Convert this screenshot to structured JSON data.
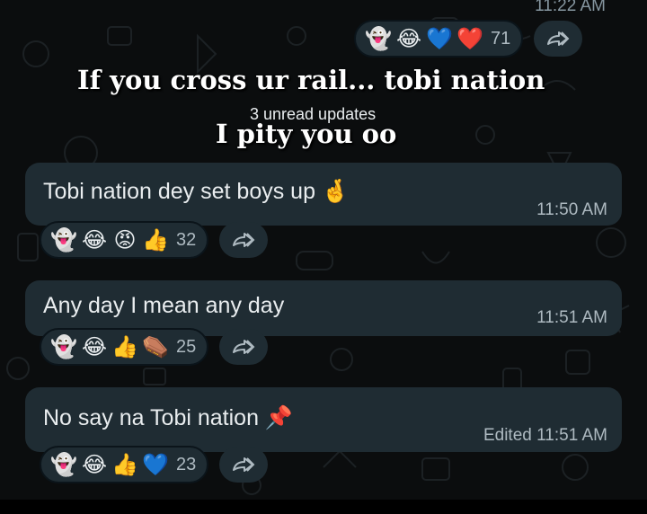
{
  "top_message": {
    "time": "11:22 AM",
    "reactions": [
      "👻",
      "😂",
      "💙",
      "❤️"
    ],
    "reaction_count": "71"
  },
  "banner": {
    "line1": "If you cross ur rail... tobi nation",
    "line2": "I pity you oo",
    "unread": "3 unread updates"
  },
  "messages": [
    {
      "text": "Tobi nation dey set boys up 🤞",
      "time": "11:50 AM",
      "reactions": [
        "👻",
        "😂",
        "😡",
        "👍"
      ],
      "reaction_count": "32"
    },
    {
      "text": "Any day I mean any day",
      "time": "11:51 AM",
      "reactions": [
        "👻",
        "😂",
        "👍",
        "⚰️"
      ],
      "reaction_count": "25"
    },
    {
      "text": "No say na Tobi nation 📌",
      "time": "Edited 11:51 AM",
      "reactions": [
        "👻",
        "😂",
        "👍",
        "💙"
      ],
      "reaction_count": "23"
    }
  ],
  "icons": {
    "share": "forward-icon"
  },
  "colors": {
    "background": "#0b0d0e",
    "bubble": "#1f2c33",
    "text": "#e9edef",
    "meta": "#aebac1"
  }
}
